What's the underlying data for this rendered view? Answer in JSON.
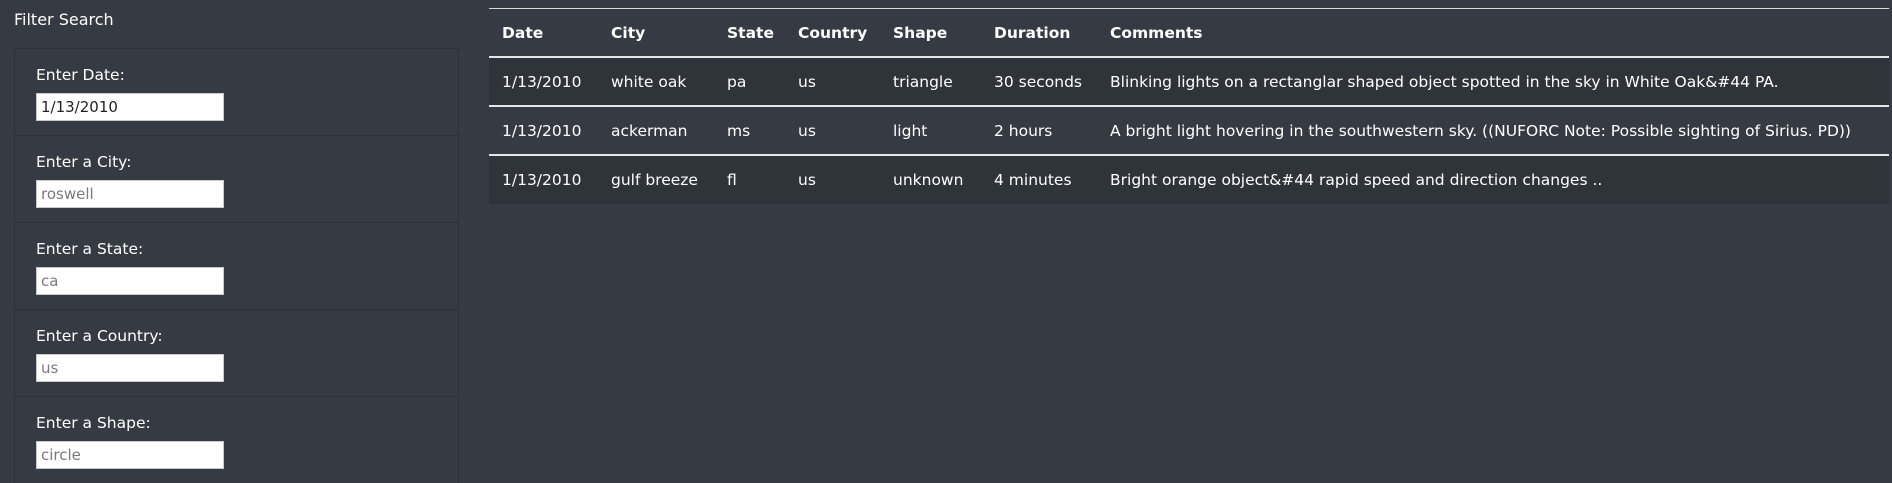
{
  "filter": {
    "title": "Filter Search",
    "fields": [
      {
        "label": "Enter Date:",
        "value": "1/13/2010",
        "placeholder": ""
      },
      {
        "label": "Enter a City:",
        "value": "",
        "placeholder": "roswell"
      },
      {
        "label": "Enter a State:",
        "value": "",
        "placeholder": "ca"
      },
      {
        "label": "Enter a Country:",
        "value": "",
        "placeholder": "us"
      },
      {
        "label": "Enter a Shape:",
        "value": "",
        "placeholder": "circle"
      }
    ]
  },
  "table": {
    "headers": [
      "Date",
      "City",
      "State",
      "Country",
      "Shape",
      "Duration",
      "Comments"
    ],
    "rows": [
      [
        "1/13/2010",
        "white oak",
        "pa",
        "us",
        "triangle",
        "30 seconds",
        "Blinking lights on a rectanglar shaped object spotted in the sky in White Oak&#44 PA."
      ],
      [
        "1/13/2010",
        "ackerman",
        "ms",
        "us",
        "light",
        "2 hours",
        "A bright light hovering in the southwestern sky. ((NUFORC Note: Possible sighting of Sirius. PD))"
      ],
      [
        "1/13/2010",
        "gulf breeze",
        "fl",
        "us",
        "unknown",
        "4 minutes",
        "Bright orange object&#44 rapid speed and direction changes .."
      ]
    ]
  }
}
